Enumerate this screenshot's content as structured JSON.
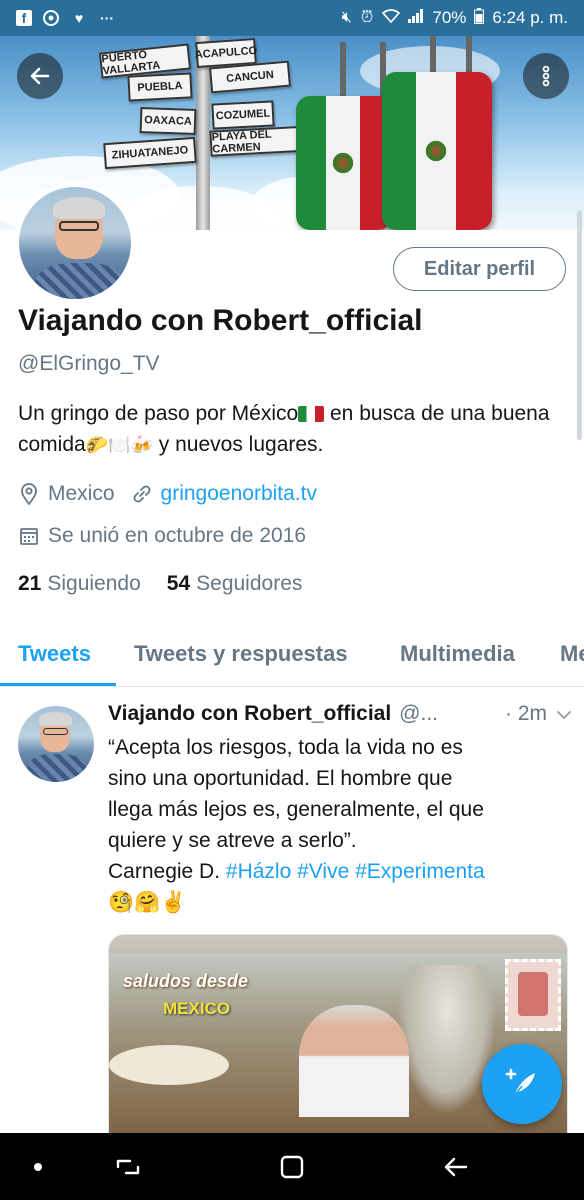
{
  "status_bar": {
    "battery": "70%",
    "time": "6:24 p. m.",
    "left_icons": [
      "facebook-icon",
      "chrome-icon",
      "heart-icon",
      "more-dots-icon"
    ],
    "right_icons": [
      "mute-icon",
      "alarm-icon",
      "wifi-icon",
      "signal-icon",
      "battery-icon"
    ]
  },
  "banner": {
    "signs": [
      "PUERTO VALLARTA",
      "ACAPULCO",
      "PUEBLA",
      "CANCUN",
      "OAXACA",
      "COZUMEL",
      "ZIHUATANEJO",
      "PLAYA DEL CARMEN"
    ]
  },
  "profile": {
    "edit_button": "Editar perfil",
    "display_name": "Viajando con Robert_official",
    "handle": "@ElGringo_TV",
    "bio_part1": "Un gringo de paso por México",
    "bio_part2": " en busca de una buena comida",
    "bio_emojis": "🌮🍽️🍻",
    "bio_part3": " y nuevos lugares.",
    "location": "Mexico",
    "website": "gringoenorbita.tv",
    "joined": "Se unió en octubre de 2016",
    "following_count": "21",
    "following_label": "Siguiendo",
    "followers_count": "54",
    "followers_label": "Seguidores"
  },
  "tabs": [
    {
      "label": "Tweets",
      "active": true
    },
    {
      "label": "Tweets y respuestas",
      "active": false
    },
    {
      "label": "Multimedia",
      "active": false
    },
    {
      "label": "Me",
      "active": false
    }
  ],
  "tweet": {
    "name": "Viajando con Robert_official",
    "username": "@...",
    "time": "· 2m",
    "text_line1": "“Acepta los riesgos, toda la vida no es",
    "text_line2": "sino una oportunidad. El hombre que",
    "text_line3": "llega más lejos es, generalmente, el que",
    "text_line4": "quiere y se atreve a serlo”.",
    "text_line5": "Carnegie D. ",
    "hashtags": [
      "#Házlo",
      "#Vive",
      "#Experimenta"
    ],
    "emojis": "🧐🤗✌️",
    "media_caption1": "saludos desde",
    "media_caption2": "MEXICO"
  },
  "colors": {
    "accent": "#1da1f2",
    "status_bar": "#2a6f9b",
    "secondary_text": "#657786",
    "primary_text": "#14171a"
  }
}
